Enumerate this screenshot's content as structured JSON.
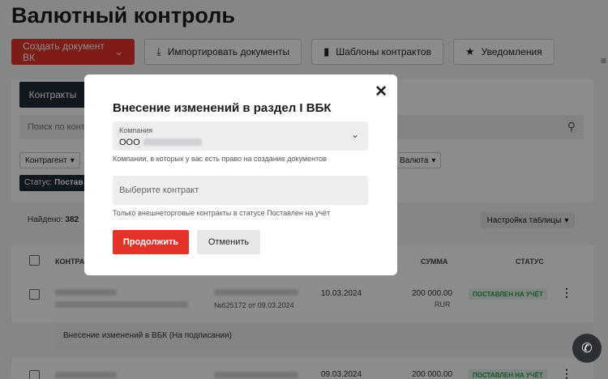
{
  "page": {
    "title": "Валютный контроль",
    "toolbar": {
      "create_label": "Создать документ ВК",
      "import_label": "Импортировать документы",
      "templates_label": "Шаблоны контрактов",
      "notifications_label": "Уведомления"
    }
  },
  "tabs": {
    "active": "Контракты"
  },
  "search": {
    "placeholder": "Поиск по контр"
  },
  "filters": {
    "counterparty": "Контрагент",
    "currency": "Валюта",
    "status_label": "Статус:",
    "status_value": "Постав"
  },
  "results": {
    "found_label": "Найдено:",
    "found_count": "382",
    "table_settings": "Настройка таблицы"
  },
  "table": {
    "headers": {
      "contract": "КОНТРА",
      "amount": "СУММА",
      "status": "СТАТУС"
    },
    "rows": [
      {
        "number": "№625172 от 09.03.2024",
        "date": "10.03.2024",
        "amount": "200 000.00",
        "currency": "RUR",
        "status": "ПОСТАВЛЕН НА УЧЁТ"
      },
      {
        "number": "",
        "date": "09.03.2024",
        "amount": "200 000.00",
        "currency": "",
        "status": "ПОСТАВЛЕН НА УЧЁТ"
      }
    ],
    "subrow": "Внесение изменений в ВБК (На подписании)"
  },
  "modal": {
    "title": "Внесение изменений в раздел I ВБК",
    "company_label": "Компания",
    "company_value": "ООО",
    "company_hint": "Компании, в которых у вас есть право на создание документов",
    "contract_placeholder": "Выберите контракт",
    "contract_hint": "Только внешнеторговые контракты в статусе Поставлен на учёт",
    "continue_label": "Продолжить",
    "cancel_label": "Отменить"
  },
  "icons": {
    "close": "close-icon",
    "chevron": "chevron-down-icon",
    "search": "search-icon",
    "download": "download-icon",
    "document": "document-icon",
    "bell": "bell-icon",
    "phone": "phone-icon"
  },
  "colors": {
    "accent_red": "#e5332a",
    "dark": "#1e2a38",
    "status_green": "#2f9a52"
  }
}
